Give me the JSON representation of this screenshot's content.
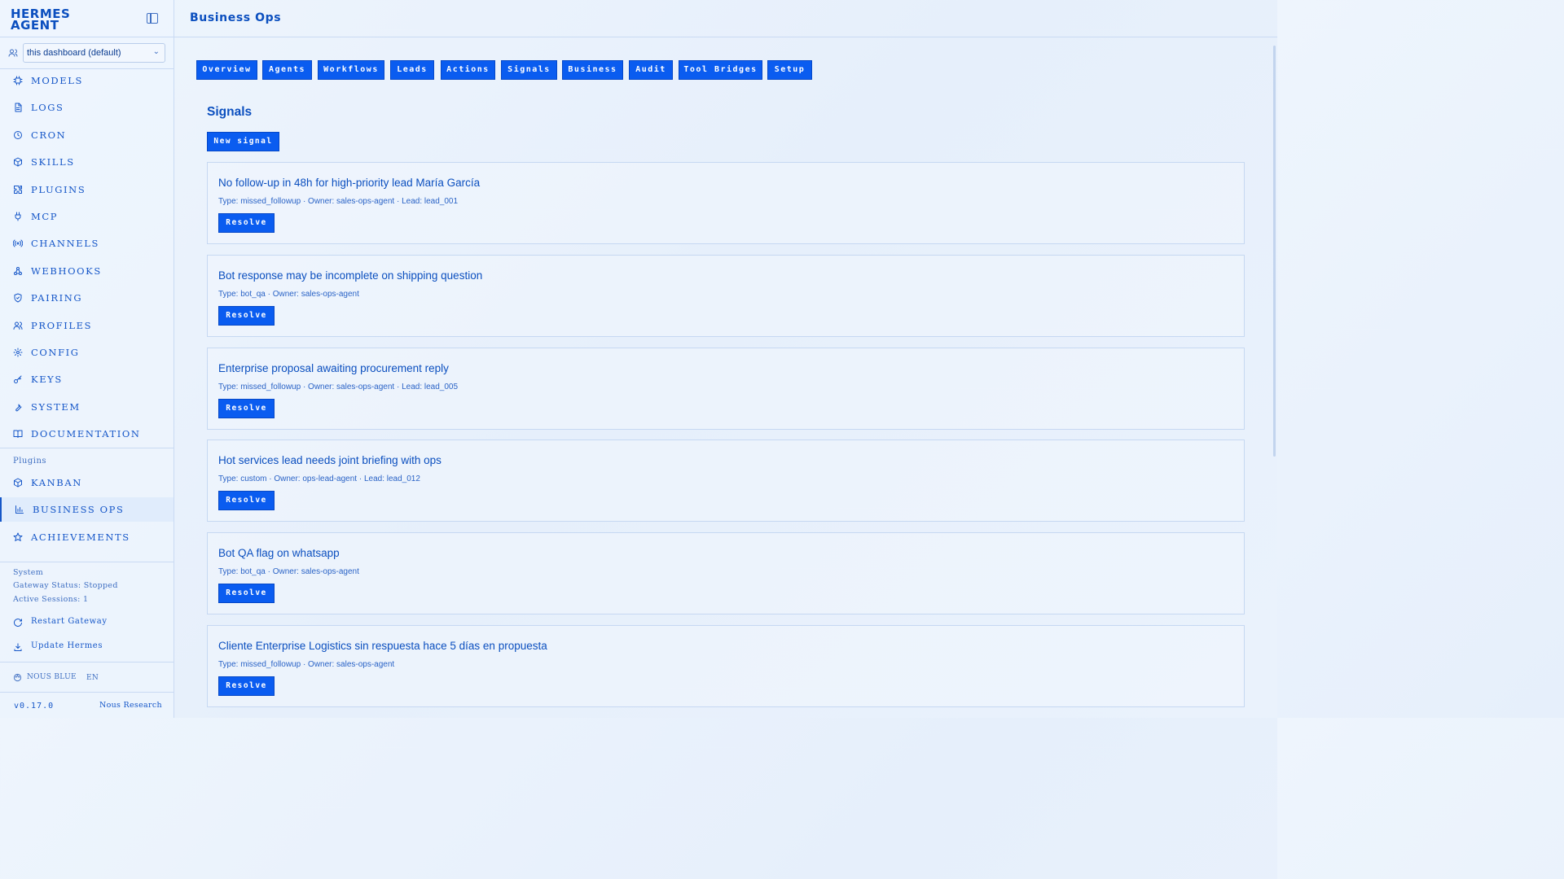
{
  "brand": {
    "line1": "HERMES",
    "line2": "AGENT"
  },
  "profile": {
    "selected": "this dashboard (default)"
  },
  "nav": {
    "items": [
      {
        "label": "MODELS",
        "icon": "cpu-icon"
      },
      {
        "label": "LOGS",
        "icon": "file-icon"
      },
      {
        "label": "CRON",
        "icon": "clock-icon"
      },
      {
        "label": "SKILLS",
        "icon": "package-icon"
      },
      {
        "label": "PLUGINS",
        "icon": "puzzle-icon"
      },
      {
        "label": "MCP",
        "icon": "plug-icon"
      },
      {
        "label": "CHANNELS",
        "icon": "radio-icon"
      },
      {
        "label": "WEBHOOKS",
        "icon": "webhook-icon"
      },
      {
        "label": "PAIRING",
        "icon": "shield-icon"
      },
      {
        "label": "PROFILES",
        "icon": "users-icon"
      },
      {
        "label": "CONFIG",
        "icon": "gear-icon"
      },
      {
        "label": "KEYS",
        "icon": "key-icon"
      },
      {
        "label": "SYSTEM",
        "icon": "wrench-icon"
      },
      {
        "label": "DOCUMENTATION",
        "icon": "book-icon"
      }
    ],
    "plugins_label": "Plugins",
    "plugin_items": [
      {
        "label": "KANBAN",
        "icon": "package-icon"
      },
      {
        "label": "BUSINESS OPS",
        "icon": "bar-chart-icon"
      },
      {
        "label": "ACHIEVEMENTS",
        "icon": "star-icon"
      }
    ]
  },
  "system": {
    "label": "System",
    "gateway_status": "Gateway Status: Stopped",
    "active_sessions": "Active Sessions: 1",
    "restart": "Restart Gateway",
    "update": "Update Hermes"
  },
  "footer": {
    "theme": "NOUS BLUE",
    "lang": "EN",
    "version": "v0.17.0",
    "org": "Nous Research"
  },
  "page": {
    "title": "Business Ops"
  },
  "tabs": [
    "Overview",
    "Agents",
    "Workflows",
    "Leads",
    "Actions",
    "Signals",
    "Business",
    "Audit",
    "Tool Bridges",
    "Setup"
  ],
  "signals": {
    "title": "Signals",
    "new_label": "New signal",
    "resolve_label": "Resolve",
    "items": [
      {
        "title": "No follow-up in 48h for high-priority lead María García",
        "meta": "Type: missed_followup · Owner: sales-ops-agent · Lead: lead_001"
      },
      {
        "title": "Bot response may be incomplete on shipping question",
        "meta": "Type: bot_qa · Owner: sales-ops-agent"
      },
      {
        "title": "Enterprise proposal awaiting procurement reply",
        "meta": "Type: missed_followup · Owner: sales-ops-agent · Lead: lead_005"
      },
      {
        "title": "Hot services lead needs joint briefing with ops",
        "meta": "Type: custom · Owner: ops-lead-agent · Lead: lead_012"
      },
      {
        "title": "Bot QA flag on whatsapp",
        "meta": "Type: bot_qa · Owner: sales-ops-agent"
      },
      {
        "title": "Cliente Enterprise Logistics sin respuesta hace 5 días en propuesta",
        "meta": "Type: missed_followup · Owner: sales-ops-agent"
      }
    ]
  },
  "colors": {
    "accent": "#0a5cf0",
    "text": "#0b4fbf",
    "border": "#c9daf3"
  }
}
